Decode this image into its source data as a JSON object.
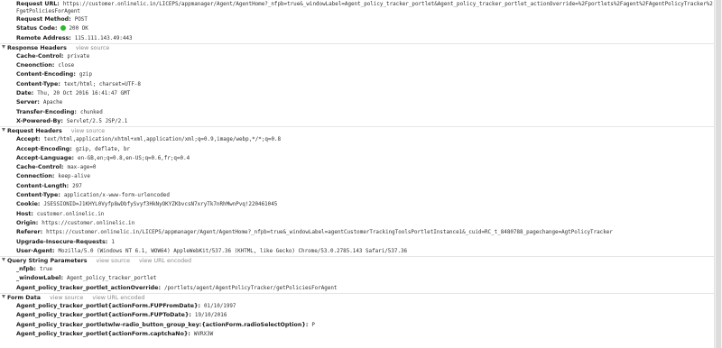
{
  "general": {
    "request_url_key": "Request URL:",
    "request_url": "https://customer.onlinelic.in/LICEPS/appmanager/Agent/AgentHome?_nfpb=true&_windowLabel=Agent_policy_tracker_portlet&Agent_policy_tracker_portlet_actionOverride=%2Fportlets%2Fagent%2FAgentPolicyTracker%2FgetPoliciesForAgent",
    "request_method_key": "Request Method:",
    "request_method": "POST",
    "status_code_key": "Status Code:",
    "status_code": "200 OK",
    "status_color": "#2eb82e",
    "remote_address_key": "Remote Address:",
    "remote_address": "115.111.143.49:443"
  },
  "response_headers": {
    "title": "Response Headers",
    "view_source": "view source",
    "rows": [
      {
        "key": "Cache-Control:",
        "value": "private"
      },
      {
        "key": "Cneonction:",
        "value": "close"
      },
      {
        "key": "Content-Encoding:",
        "value": "gzip"
      },
      {
        "key": "Content-Type:",
        "value": "text/html; charset=UTF-8"
      },
      {
        "key": "Date:",
        "value": "Thu, 20 Oct 2016 16:41:47 GMT"
      },
      {
        "key": "Server:",
        "value": "Apache"
      },
      {
        "key": "Transfer-Encoding:",
        "value": "chunked"
      },
      {
        "key": "X-Powered-By:",
        "value": "Servlet/2.5 JSP/2.1"
      }
    ]
  },
  "request_headers": {
    "title": "Request Headers",
    "view_source": "view source",
    "rows": [
      {
        "key": "Accept:",
        "value": "text/html,application/xhtml+xml,application/xml;q=0.9,image/webp,*/*;q=0.8"
      },
      {
        "key": "Accept-Encoding:",
        "value": "gzip, deflate, br"
      },
      {
        "key": "Accept-Language:",
        "value": "en-GB,en;q=0.8,en-US;q=0.6,fr;q=0.4"
      },
      {
        "key": "Cache-Control:",
        "value": "max-age=0"
      },
      {
        "key": "Connection:",
        "value": "keep-alive"
      },
      {
        "key": "Content-Length:",
        "value": "297"
      },
      {
        "key": "Content-Type:",
        "value": "application/x-www-form-urlencoded"
      },
      {
        "key": "Cookie:",
        "value": "JSESSIONID=J1KHYL0Vyfp8wDbfySvyf3HkNyOKYZKbvcsN7xryTk7nRhMwnPvq!220461045"
      },
      {
        "key": "Host:",
        "value": "customer.onlinelic.in"
      },
      {
        "key": "Origin:",
        "value": "https://customer.onlinelic.in"
      },
      {
        "key": "Referer:",
        "value": "https://customer.onlinelic.in/LICEPS/appmanager/Agent/AgentHome?_nfpb=true&_windowLabel=agentCustomerTrackingToolsPortletInstance1&_cuid=RC_t_8480788_pagechange=AgtPolicyTracker"
      },
      {
        "key": "Upgrade-Insecure-Requests:",
        "value": "1"
      },
      {
        "key": "User-Agent:",
        "value": "Mozilla/5.0 (Windows NT 6.1, WOW64) AppleWebKit/537.36 (KHTML, like Gecko) Chrome/53.0.2785.143 Safari/537.36"
      }
    ]
  },
  "query_string": {
    "title": "Query String Parameters",
    "view_source": "view source",
    "view_url_encoded": "view URL encoded",
    "rows": [
      {
        "key": "_nfpb:",
        "value": "true"
      },
      {
        "key": "_windowLabel:",
        "value": "Agent_policy_tracker_portlet"
      },
      {
        "key": "Agent_policy_tracker_portlet_actionOverride:",
        "value": "/portlets/agent/AgentPolicyTracker/getPoliciesForAgent"
      }
    ]
  },
  "form_data": {
    "title": "Form Data",
    "view_source": "view source",
    "view_url_encoded": "view URL encoded",
    "rows": [
      {
        "key": "Agent_policy_tracker_portlet{actionForm.FUPFromDate}:",
        "value": "01/10/1997"
      },
      {
        "key": "Agent_policy_tracker_portlet{actionForm.FUPToDate}:",
        "value": "19/10/2016"
      },
      {
        "key": "Agent_policy_tracker_portletwlw-radio_button_group_key:{actionForm.radioSelectOption}:",
        "value": "P"
      },
      {
        "key": "Agent_policy_tracker_portlet{actionForm.captchaNo}:",
        "value": "WVRX3W"
      }
    ]
  }
}
